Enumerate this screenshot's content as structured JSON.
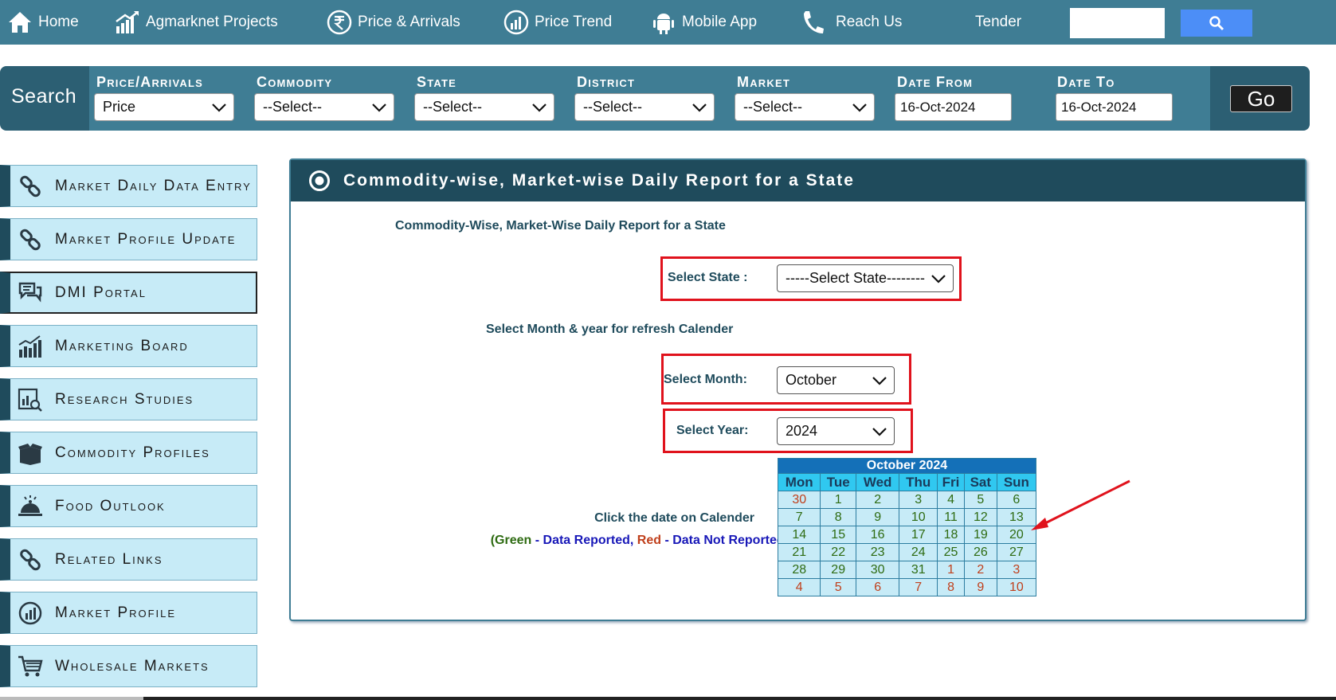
{
  "nav": {
    "items": [
      {
        "label": "Home",
        "icon": "home-icon"
      },
      {
        "label": "Agmarknet Projects",
        "icon": "chart-growth-icon"
      },
      {
        "label": "Price & Arrivals",
        "icon": "rupee-icon"
      },
      {
        "label": "Price Trend",
        "icon": "trend-gauge-icon"
      },
      {
        "label": "Mobile App",
        "icon": "android-icon"
      },
      {
        "label": "Reach Us",
        "icon": "phone-icon"
      },
      {
        "label": "Tender",
        "icon": ""
      }
    ],
    "search_value": ""
  },
  "searchbar": {
    "title": "Search",
    "fields": [
      {
        "label": "Price/Arrivals",
        "value": "Price"
      },
      {
        "label": "Commodity",
        "value": "--Select--"
      },
      {
        "label": "State",
        "value": "--Select--"
      },
      {
        "label": "District",
        "value": "--Select--"
      },
      {
        "label": "Market",
        "value": "--Select--"
      }
    ],
    "date_from_label": "Date From",
    "date_from": "16-Oct-2024",
    "date_to_label": "Date To",
    "date_to": "16-Oct-2024",
    "go_label": "Go"
  },
  "sidebar": {
    "items": [
      {
        "label": "Market Daily Data Entry",
        "icon": "link-icon"
      },
      {
        "label": "Market Profile Update",
        "icon": "link-icon"
      },
      {
        "label": "DMI Portal",
        "icon": "chat-bubbles-icon"
      },
      {
        "label": "Marketing Board",
        "icon": "bar-chart-icon"
      },
      {
        "label": "Research Studies",
        "icon": "report-search-icon"
      },
      {
        "label": "Commodity Profiles",
        "icon": "box-icon"
      },
      {
        "label": "Food Outlook",
        "icon": "food-cloche-icon"
      },
      {
        "label": "Related Links",
        "icon": "link-icon"
      },
      {
        "label": "Market Profile",
        "icon": "market-gauge-icon"
      },
      {
        "label": "Wholesale Markets",
        "icon": "cart-icon"
      }
    ]
  },
  "panel": {
    "title": "Commodity-wise, Market-wise Daily Report for a State",
    "subtitle": "Commodity-Wise, Market-Wise Daily Report for a State",
    "state_label": "Select State :",
    "state_value": "-----Select State--------",
    "refresh_label": "Select Month & year for refresh Calender",
    "month_label": "Select Month:",
    "month_value": "October",
    "year_label": "Select Year:",
    "year_value": "2024",
    "click_label": "Click the date on Calender",
    "legend": {
      "open": "(",
      "green": "Green",
      "dash1": " - ",
      "reported": "Data Reported, ",
      "red": "Red",
      "dash2": " - ",
      "not_reported": "Data Not Reported",
      "close": ")"
    }
  },
  "calendar": {
    "title": "October 2024",
    "days": [
      "Mon",
      "Tue",
      "Wed",
      "Thu",
      "Fri",
      "Sat",
      "Sun"
    ],
    "weeks": [
      [
        {
          "d": "30",
          "c": "red"
        },
        {
          "d": "1",
          "c": "green"
        },
        {
          "d": "2",
          "c": "green"
        },
        {
          "d": "3",
          "c": "green"
        },
        {
          "d": "4",
          "c": "green"
        },
        {
          "d": "5",
          "c": "green"
        },
        {
          "d": "6",
          "c": "green"
        }
      ],
      [
        {
          "d": "7",
          "c": "green"
        },
        {
          "d": "8",
          "c": "green"
        },
        {
          "d": "9",
          "c": "green"
        },
        {
          "d": "10",
          "c": "green"
        },
        {
          "d": "11",
          "c": "green"
        },
        {
          "d": "12",
          "c": "green"
        },
        {
          "d": "13",
          "c": "green"
        }
      ],
      [
        {
          "d": "14",
          "c": "green"
        },
        {
          "d": "15",
          "c": "green"
        },
        {
          "d": "16",
          "c": "green"
        },
        {
          "d": "17",
          "c": "green"
        },
        {
          "d": "18",
          "c": "green"
        },
        {
          "d": "19",
          "c": "green"
        },
        {
          "d": "20",
          "c": "green"
        }
      ],
      [
        {
          "d": "21",
          "c": "green"
        },
        {
          "d": "22",
          "c": "green"
        },
        {
          "d": "23",
          "c": "green"
        },
        {
          "d": "24",
          "c": "green"
        },
        {
          "d": "25",
          "c": "green"
        },
        {
          "d": "26",
          "c": "green"
        },
        {
          "d": "27",
          "c": "green"
        }
      ],
      [
        {
          "d": "28",
          "c": "green"
        },
        {
          "d": "29",
          "c": "green"
        },
        {
          "d": "30",
          "c": "green"
        },
        {
          "d": "31",
          "c": "green"
        },
        {
          "d": "1",
          "c": "red"
        },
        {
          "d": "2",
          "c": "red"
        },
        {
          "d": "3",
          "c": "red"
        }
      ],
      [
        {
          "d": "4",
          "c": "red"
        },
        {
          "d": "5",
          "c": "red"
        },
        {
          "d": "6",
          "c": "red"
        },
        {
          "d": "7",
          "c": "red"
        },
        {
          "d": "8",
          "c": "red"
        },
        {
          "d": "9",
          "c": "red"
        },
        {
          "d": "10",
          "c": "red"
        }
      ]
    ]
  },
  "colors": {
    "nav_bg": "#3f7d94",
    "header_bg": "#1f4b5c",
    "highlight_red": "#e0121c",
    "reported_green": "#2e6b12",
    "not_reported_red": "#c0401c"
  }
}
